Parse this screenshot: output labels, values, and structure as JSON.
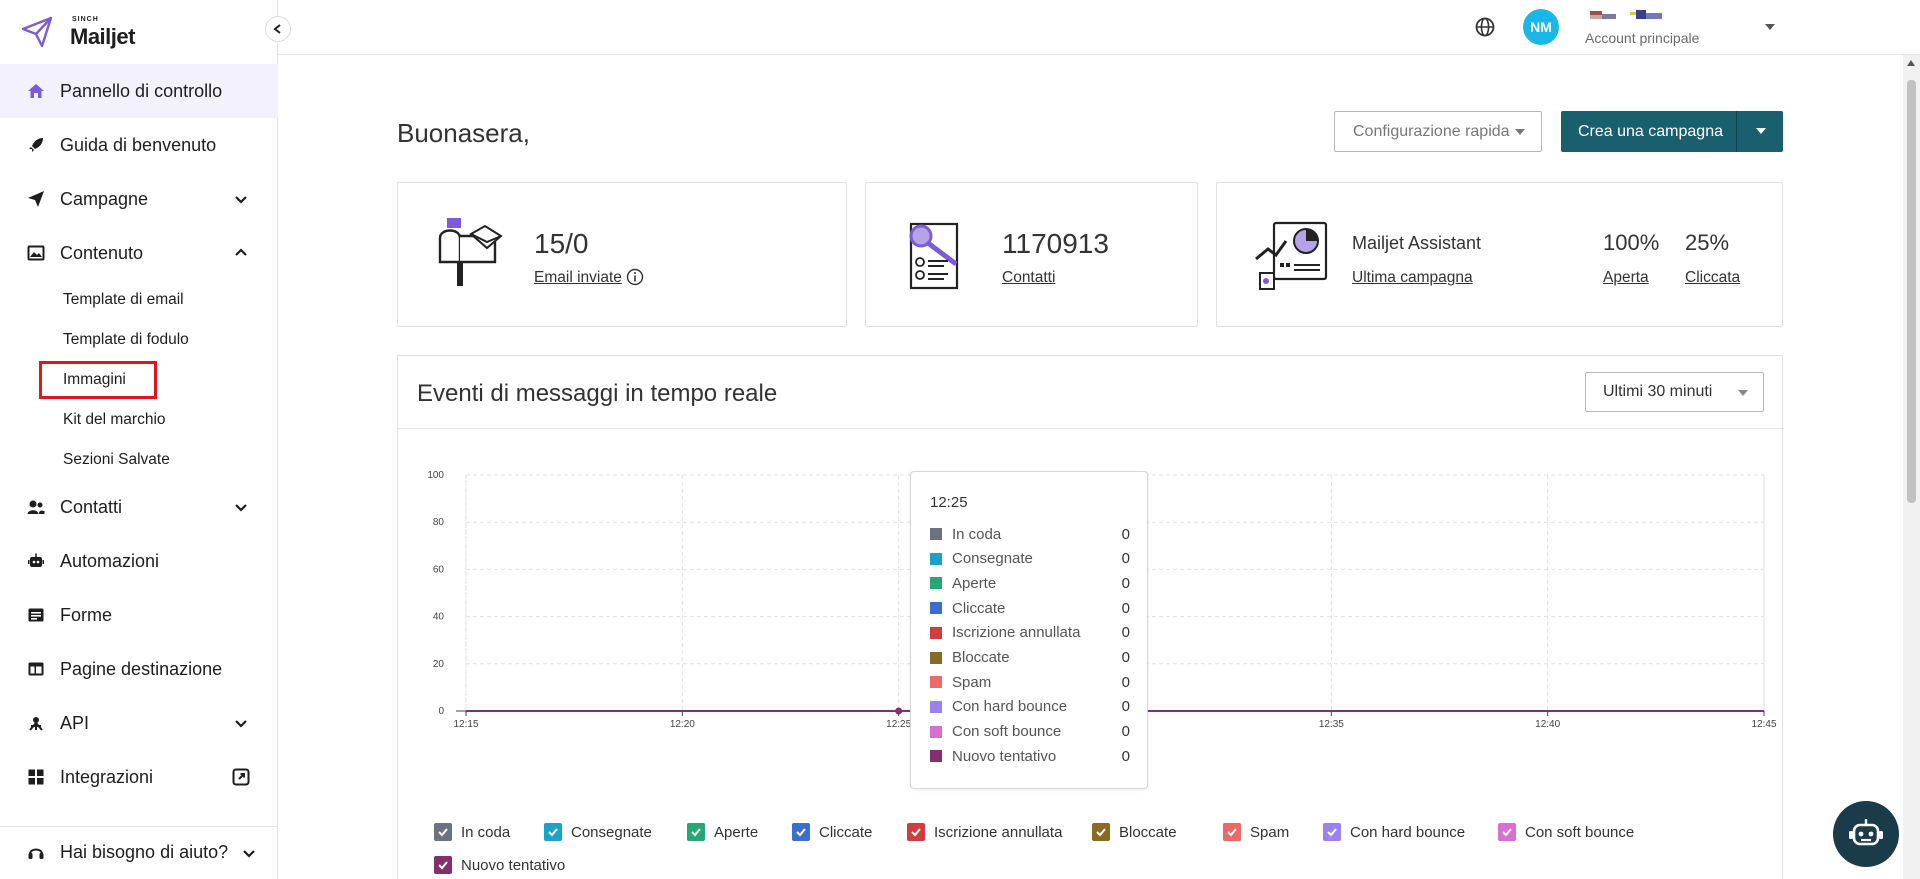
{
  "brand": {
    "small": "SINCH",
    "name": "Mailjet"
  },
  "sidebar": {
    "items": [
      {
        "label": "Pannello di controllo",
        "icon": "home-icon",
        "active": true
      },
      {
        "label": "Guida di benvenuto",
        "icon": "rocket-icon"
      },
      {
        "label": "Campagne",
        "icon": "send-icon",
        "expand": "down"
      },
      {
        "label": "Contenuto",
        "icon": "image-icon",
        "expand": "up"
      },
      {
        "label": "Contatti",
        "icon": "users-icon",
        "expand": "down"
      },
      {
        "label": "Automazioni",
        "icon": "robot-icon"
      },
      {
        "label": "Forme",
        "icon": "form-icon"
      },
      {
        "label": "Pagine destinazione",
        "icon": "layout-icon"
      },
      {
        "label": "API",
        "icon": "api-icon",
        "expand": "down"
      },
      {
        "label": "Integrazioni",
        "icon": "grid-icon",
        "external": true
      }
    ],
    "content_sub": [
      "Template di email",
      "Template di fodulo",
      "Immagini",
      "Kit del marchio",
      "Sezioni Salvate"
    ],
    "help": "Hai bisogno di aiuto?"
  },
  "header": {
    "avatar_initials": "NM",
    "account_label": "Account principale"
  },
  "main": {
    "greeting": "Buonasera,",
    "quick_config": "Configurazione rapida",
    "create_campaign": "Crea una campagna"
  },
  "cards": {
    "emails": {
      "value": "15/0",
      "link": "Email inviate"
    },
    "contacts": {
      "value": "1170913",
      "link": "Contatti"
    },
    "assistant": {
      "title": "Mailjet Assistant",
      "link": "Ultima campagna",
      "open_pct": "100%",
      "open_label": "Aperta",
      "click_pct": "25%",
      "click_label": "Cliccata"
    }
  },
  "events": {
    "title": "Eventi di messaggi in tempo reale",
    "range": "Ultimi 30 minuti"
  },
  "chart_data": {
    "type": "line",
    "x": [
      "12:15",
      "12:20",
      "12:25",
      "12:30",
      "12:35",
      "12:40",
      "12:45"
    ],
    "x_ticks": [
      "12:15",
      "12:20",
      "12:25",
      "12:35",
      "12:40",
      "12:45"
    ],
    "y_ticks": [
      0,
      20,
      40,
      60,
      80,
      100
    ],
    "ylim": [
      0,
      100
    ],
    "grid": true,
    "series": [
      {
        "name": "In coda",
        "color": "#6b7280",
        "values": [
          0,
          0,
          0,
          0,
          0,
          0,
          0
        ]
      },
      {
        "name": "Consegnate",
        "color": "#1aa3c7",
        "values": [
          0,
          0,
          0,
          0,
          0,
          0,
          0
        ]
      },
      {
        "name": "Aperte",
        "color": "#26a971",
        "values": [
          0,
          0,
          0,
          0,
          0,
          0,
          0
        ]
      },
      {
        "name": "Cliccate",
        "color": "#3a6fcf",
        "values": [
          0,
          0,
          0,
          0,
          0,
          0,
          0
        ]
      },
      {
        "name": "Iscrizione annullata",
        "color": "#cf3d3d",
        "values": [
          0,
          0,
          0,
          0,
          0,
          0,
          0
        ]
      },
      {
        "name": "Bloccate",
        "color": "#8a6a23",
        "values": [
          0,
          0,
          0,
          0,
          0,
          0,
          0
        ]
      },
      {
        "name": "Spam",
        "color": "#ec6a66",
        "values": [
          0,
          0,
          0,
          0,
          0,
          0,
          0
        ]
      },
      {
        "name": "Con hard bounce",
        "color": "#9b82f0",
        "values": [
          0,
          0,
          0,
          0,
          0,
          0,
          0
        ]
      },
      {
        "name": "Con soft bounce",
        "color": "#d86fd3",
        "values": [
          0,
          0,
          0,
          0,
          0,
          0,
          0
        ]
      },
      {
        "name": "Nuovo tentativo",
        "color": "#85306e",
        "values": [
          0,
          0,
          0,
          0,
          0,
          0,
          0
        ]
      }
    ],
    "tooltip": {
      "time": "12:25",
      "rows": [
        {
          "name": "In coda",
          "value": "0"
        },
        {
          "name": "Consegnate",
          "value": "0"
        },
        {
          "name": "Aperte",
          "value": "0"
        },
        {
          "name": "Cliccate",
          "value": "0"
        },
        {
          "name": "Iscrizione annullata",
          "value": "0"
        },
        {
          "name": "Bloccate",
          "value": "0"
        },
        {
          "name": "Spam",
          "value": "0"
        },
        {
          "name": "Con hard bounce",
          "value": "0"
        },
        {
          "name": "Con soft bounce",
          "value": "0"
        },
        {
          "name": "Nuovo tentativo",
          "value": "0"
        }
      ]
    }
  }
}
